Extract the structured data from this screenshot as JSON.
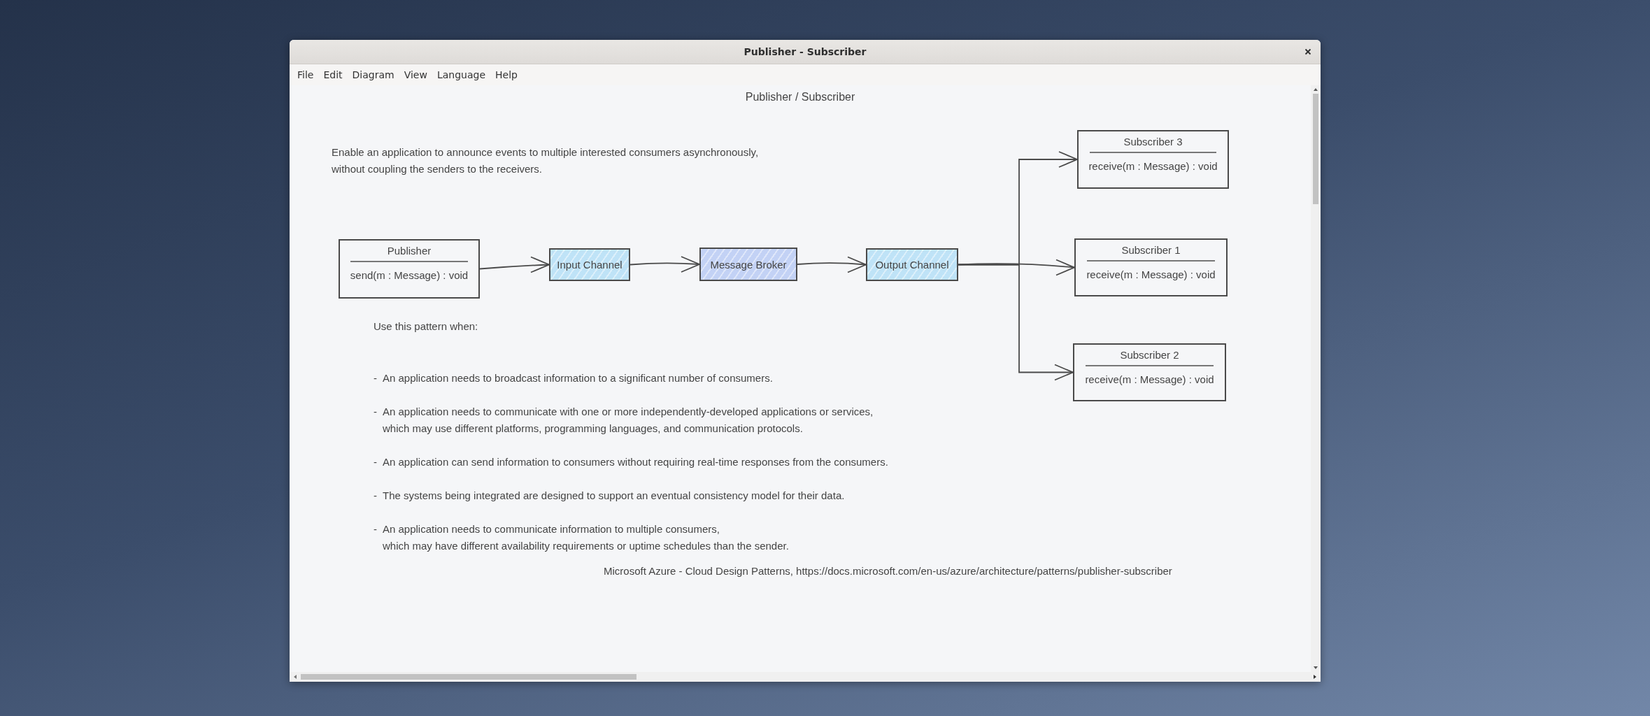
{
  "window": {
    "title": "Publisher - Subscriber"
  },
  "menu": [
    "File",
    "Edit",
    "Diagram",
    "View",
    "Language",
    "Help"
  ],
  "diagram": {
    "title": "Publisher / Subscriber",
    "description": "Enable an application to announce events to multiple interested consumers asynchronously,\nwithout coupling the senders to the receivers.",
    "nodes": [
      {
        "kind": "class",
        "name": "Publisher",
        "method": "send(m : Message) : void"
      },
      {
        "kind": "component",
        "name": "Input Channel",
        "color": "#bfe3f7"
      },
      {
        "kind": "component",
        "name": "Message Broker",
        "color": "#c3d2f5"
      },
      {
        "kind": "component",
        "name": "Output Channel",
        "color": "#bfe3f7"
      },
      {
        "kind": "class",
        "name": "Subscriber 3",
        "method": "receive(m : Message) : void"
      },
      {
        "kind": "class",
        "name": "Subscriber 1",
        "method": "receive(m : Message) : void"
      },
      {
        "kind": "class",
        "name": "Subscriber 2",
        "method": "receive(m : Message) : void"
      }
    ],
    "usage_heading": "Use this pattern when:",
    "bullet_mark": "-",
    "usage_items": [
      "An application needs to broadcast information to a significant number of consumers.",
      "An application needs to communicate with one or more independently-developed applications or services,\nwhich may use different platforms, programming languages, and communication protocols.",
      "An application can send information to consumers without requiring real-time responses from the consumers.",
      "The systems being integrated are designed to support an eventual consistency model for their data.",
      "An application needs to communicate information to multiple consumers,\nwhich may have different availability requirements or uptime schedules than the sender."
    ],
    "citation": "Microsoft Azure - Cloud Design Patterns, https://docs.microsoft.com/en-us/azure/architecture/patterns/publisher-subscriber"
  }
}
